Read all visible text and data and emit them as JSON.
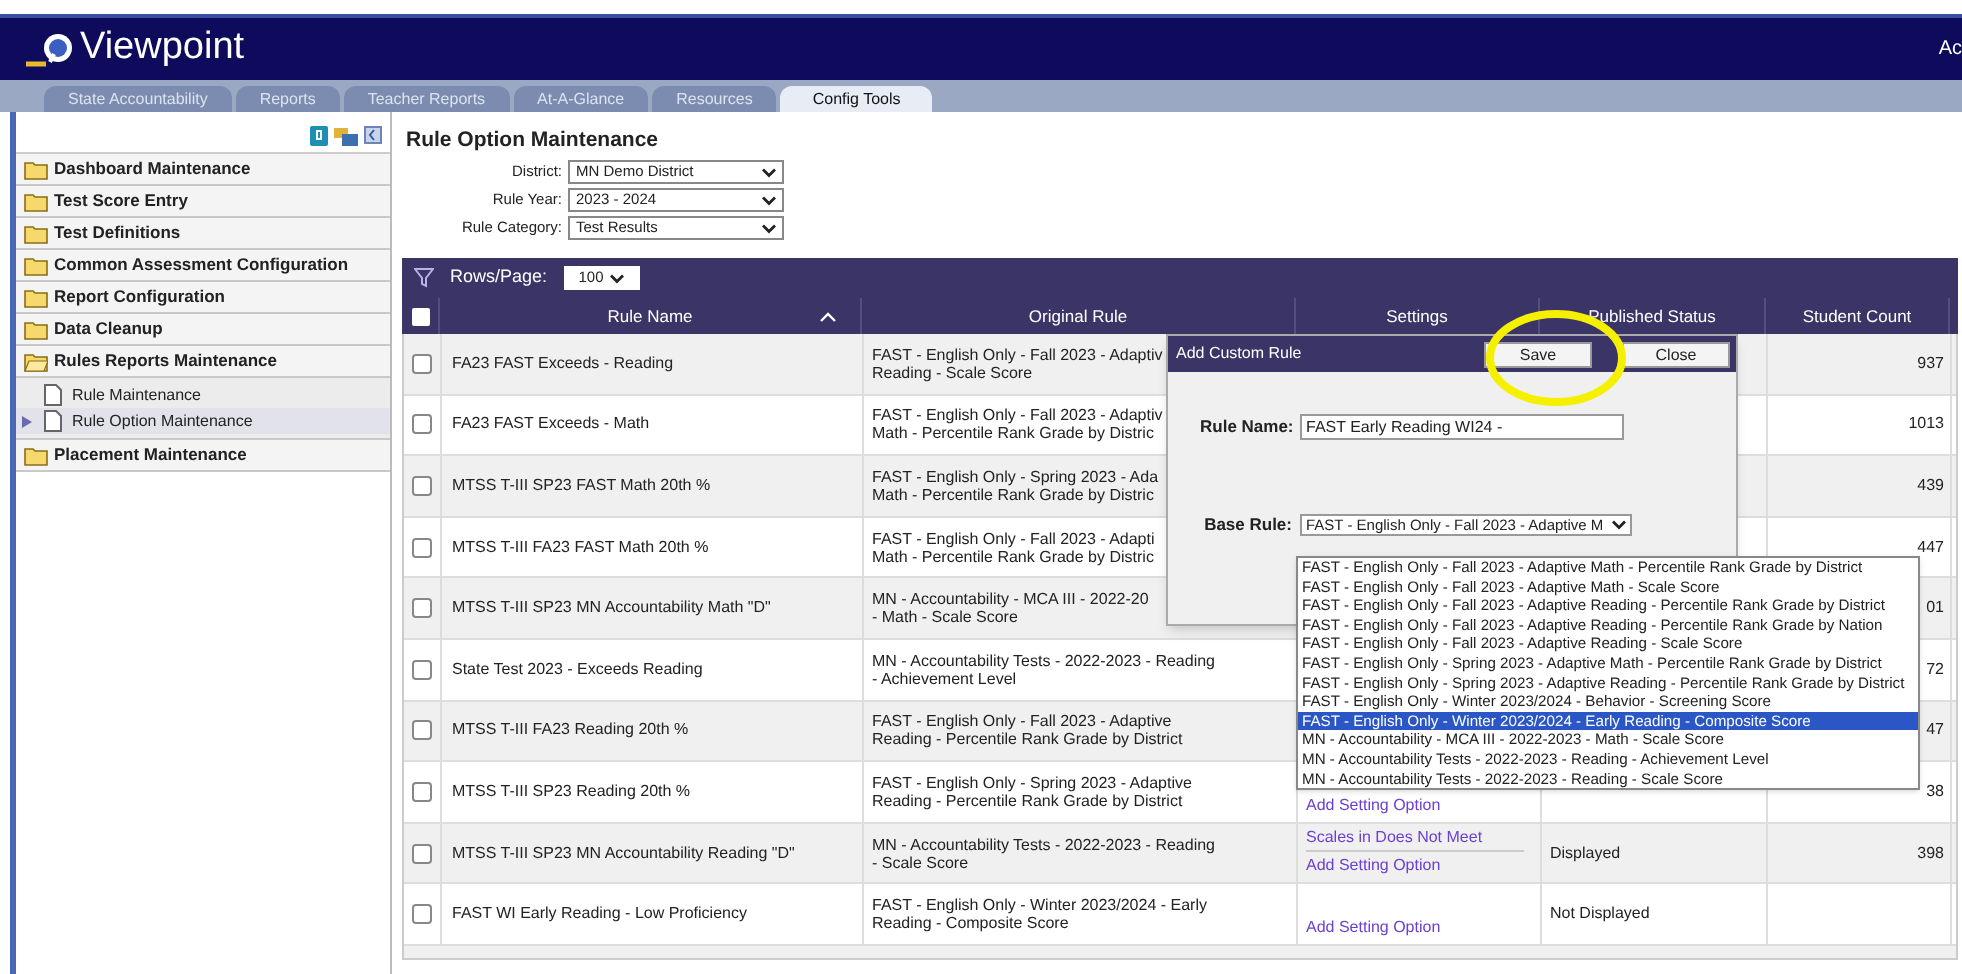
{
  "app": {
    "logo": "Viewpoint",
    "header_right": "Ac"
  },
  "tabs": [
    {
      "label": "State Accountability",
      "selected": false
    },
    {
      "label": "Reports",
      "selected": false
    },
    {
      "label": "Teacher Reports",
      "selected": false
    },
    {
      "label": "At-A-Glance",
      "selected": false
    },
    {
      "label": "Resources",
      "selected": false
    },
    {
      "label": "Config Tools",
      "selected": true
    }
  ],
  "sidebar": {
    "items": [
      {
        "label": "Dashboard Maintenance",
        "expanded": false
      },
      {
        "label": "Test Score Entry",
        "expanded": false
      },
      {
        "label": "Test Definitions",
        "expanded": false
      },
      {
        "label": "Common Assessment Configuration",
        "expanded": false
      },
      {
        "label": "Report Configuration",
        "expanded": false
      },
      {
        "label": "Data Cleanup",
        "expanded": false
      },
      {
        "label": "Rules Reports Maintenance",
        "expanded": true,
        "children": [
          {
            "label": "Rule Maintenance",
            "selected": false
          },
          {
            "label": "Rule Option Maintenance",
            "selected": true
          }
        ]
      },
      {
        "label": "Placement Maintenance",
        "expanded": false
      }
    ]
  },
  "page_title": "Rule Option Maintenance",
  "filters": [
    {
      "label": "District:",
      "value": "MN Demo District"
    },
    {
      "label": "Rule Year:",
      "value": "2023 - 2024"
    },
    {
      "label": "Rule Category:",
      "value": "Test Results"
    }
  ],
  "table": {
    "select_all_checked": false,
    "rows_per_page_label": "Rows/Page:",
    "rows_per_page": "100",
    "columns": [
      "Rule Name",
      "Original Rule",
      "Settings",
      "Published Status",
      "Student Count"
    ],
    "rows": [
      {
        "checked": false,
        "rule_name": "FA23 FAST Exceeds - Reading",
        "original_rule": [
          "FAST - English Only - Fall 2023 - Adaptiv",
          "Reading - Scale Score"
        ],
        "count": "937"
      },
      {
        "checked": false,
        "rule_name": "FA23 FAST Exceeds - Math",
        "original_rule": [
          "FAST - English Only - Fall 2023 - Adaptiv",
          "Math - Percentile Rank Grade by Distric"
        ],
        "count": "1013"
      },
      {
        "checked": false,
        "rule_name": "MTSS T-III SP23 FAST Math 20th %",
        "original_rule": [
          "FAST - English Only - Spring 2023 - Ada",
          "Math - Percentile Rank Grade by Distric"
        ],
        "count": "439"
      },
      {
        "checked": false,
        "rule_name": "MTSS T-III FA23 FAST Math 20th %",
        "original_rule": [
          "FAST - English Only - Fall 2023 - Adapti",
          "Math - Percentile Rank Grade by Distric"
        ],
        "count": "447"
      },
      {
        "checked": false,
        "rule_name": "MTSS T-III SP23 MN Accountability Math \"D\"",
        "original_rule": [
          "MN - Accountability - MCA III - 2022-20",
          "- Math - Scale Score"
        ],
        "count": "01"
      },
      {
        "checked": false,
        "rule_name": "State Test 2023 - Exceeds Reading",
        "original_rule": [
          "MN - Accountability Tests - 2022-2023 - Reading",
          "- Achievement Level"
        ],
        "count": "72"
      },
      {
        "checked": false,
        "rule_name": "MTSS T-III FA23 Reading 20th %",
        "original_rule": [
          "FAST - English Only - Fall 2023 - Adaptive",
          "Reading - Percentile Rank Grade by District"
        ],
        "count": "47"
      },
      {
        "checked": false,
        "rule_name": "MTSS T-III SP23 Reading 20th %",
        "original_rule": [
          "FAST - English Only - Spring 2023 - Adaptive",
          "Reading - Percentile Rank Grade by District"
        ],
        "settings": [
          "Add Setting Option"
        ],
        "count": "38"
      },
      {
        "checked": false,
        "rule_name": "MTSS T-III SP23 MN Accountability Reading \"D\"",
        "original_rule": [
          "MN - Accountability Tests - 2022-2023 - Reading",
          "- Scale Score"
        ],
        "settings": [
          "Scales in Does Not Meet",
          "Add Setting Option"
        ],
        "status": "Displayed",
        "count": "398"
      },
      {
        "checked": false,
        "rule_name": "FAST WI Early Reading - Low Proficiency",
        "original_rule": [
          "FAST - English Only - Winter 2023/2024 - Early",
          "Reading - Composite Score"
        ],
        "settings": [
          "Add Setting Option"
        ],
        "status": "Not Displayed"
      }
    ]
  },
  "dialog": {
    "title": "Add Custom Rule",
    "buttons": [
      "Save",
      "Close"
    ],
    "rule_name": {
      "label": "Rule Name:",
      "value": "FAST Early Reading WI24 -"
    },
    "base_rule": {
      "label": "Base Rule:",
      "value": "FAST - English Only - Fall 2023 - Adaptive M",
      "options": [
        {
          "label": "FAST - English Only - Fall 2023 - Adaptive Math - Percentile Rank Grade by District",
          "selected": false
        },
        {
          "label": "FAST - English Only - Fall 2023 - Adaptive Math - Scale Score",
          "selected": false
        },
        {
          "label": "FAST - English Only - Fall 2023 - Adaptive Reading - Percentile Rank Grade by District",
          "selected": false
        },
        {
          "label": "FAST - English Only - Fall 2023 - Adaptive Reading - Percentile Rank Grade by Nation",
          "selected": false
        },
        {
          "label": "FAST - English Only - Fall 2023 - Adaptive Reading - Scale Score",
          "selected": false
        },
        {
          "label": "FAST - English Only - Spring 2023 - Adaptive Math - Percentile Rank Grade by District",
          "selected": false
        },
        {
          "label": "FAST - English Only - Spring 2023 - Adaptive Reading - Percentile Rank Grade by District",
          "selected": false
        },
        {
          "label": "FAST - English Only - Winter 2023/2024 - Behavior - Screening Score",
          "selected": false
        },
        {
          "label": "FAST - English Only - Winter 2023/2024 - Early Reading - Composite Score",
          "selected": true
        },
        {
          "label": "MN - Accountability - MCA III - 2022-2023 - Math - Scale Score",
          "selected": false
        },
        {
          "label": "MN - Accountability Tests - 2022-2023 - Reading - Achievement Level",
          "selected": false
        },
        {
          "label": "MN - Accountability Tests - 2022-2023 - Reading - Scale Score",
          "selected": false
        }
      ]
    }
  }
}
